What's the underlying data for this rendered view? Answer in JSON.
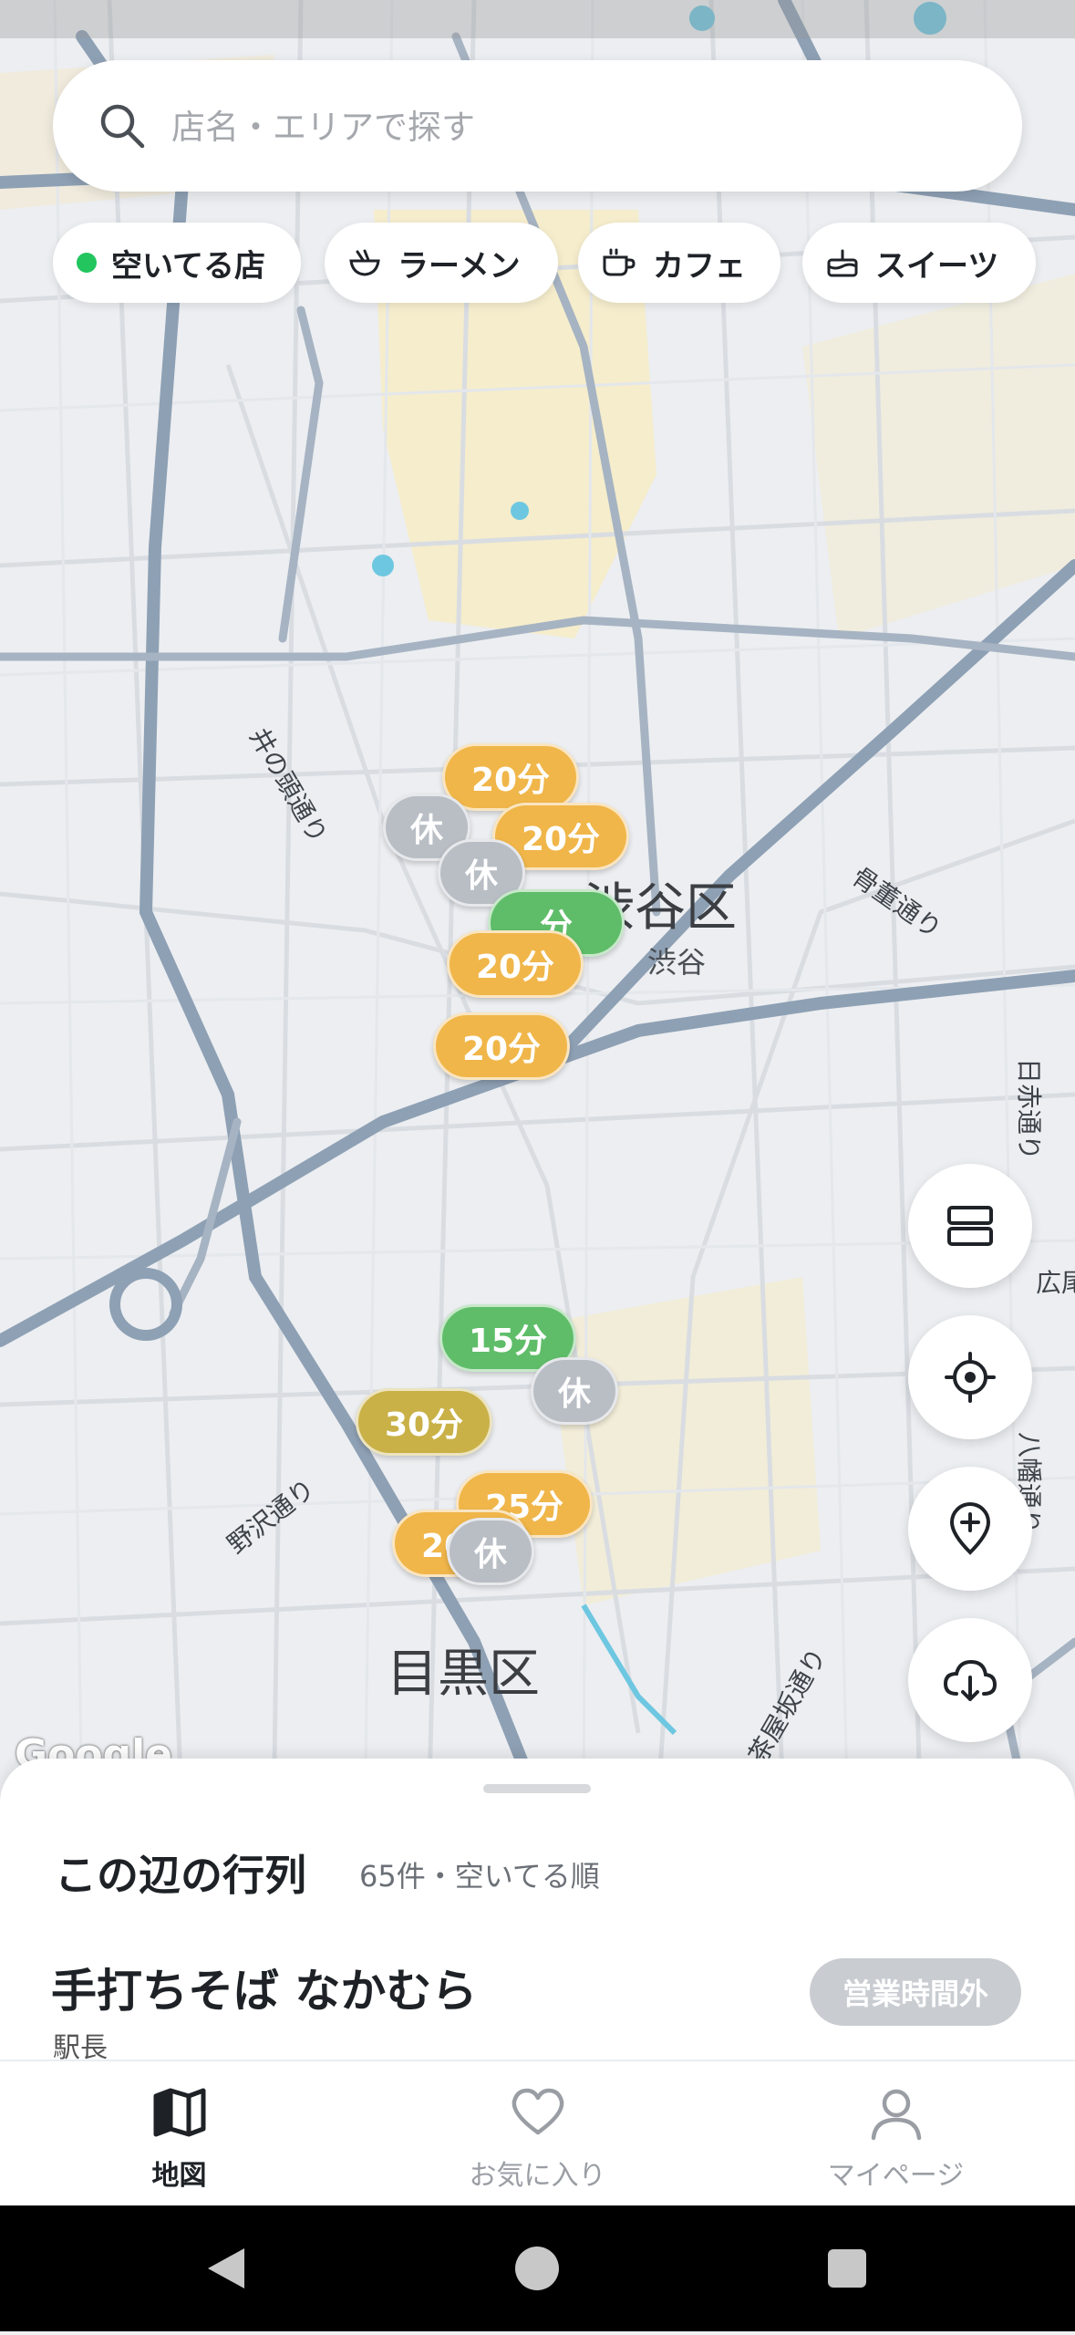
{
  "search": {
    "placeholder": "店名・エリアで探す"
  },
  "filters": [
    {
      "label": "空いてる店",
      "icon": "green-dot-icon"
    },
    {
      "label": "ラーメン",
      "icon": "ramen-bowl-icon"
    },
    {
      "label": "カフェ",
      "icon": "coffee-cup-icon"
    },
    {
      "label": "スイーツ",
      "icon": "cake-icon"
    }
  ],
  "map": {
    "wards": [
      "渋谷区",
      "目黒区"
    ],
    "stations": [
      "渋谷"
    ],
    "roads": [
      "井の頭通り",
      "骨董通り",
      "日赤通り",
      "野沢通り",
      "八幡通り",
      "広尾",
      "茶屋坂通り"
    ],
    "attribution": "Google",
    "colors": {
      "busy": "#f0b64a",
      "vacant": "#5fbd69",
      "closed": "#b9bec5"
    }
  },
  "pins": [
    {
      "label": "20分",
      "status": "orange"
    },
    {
      "label": "休",
      "status": "grey"
    },
    {
      "label": "20分",
      "status": "orange"
    },
    {
      "label": "休",
      "status": "grey"
    },
    {
      "label": "分",
      "status": "green"
    },
    {
      "label": "20分",
      "status": "orange"
    },
    {
      "label": "20分",
      "status": "orange"
    },
    {
      "label": "15分",
      "status": "green"
    },
    {
      "label": "休",
      "status": "grey"
    },
    {
      "label": "30分",
      "status": "olive"
    },
    {
      "label": "25分",
      "status": "orange"
    },
    {
      "label": "20分",
      "status": "orange"
    },
    {
      "label": "休",
      "status": "grey"
    }
  ],
  "fabs": [
    "list-view-icon",
    "my-location-icon",
    "add-pin-icon",
    "download-cloud-icon"
  ],
  "sheet": {
    "title": "この辺の行列",
    "meta": "65件・空いてる順",
    "shop_name": "手打ちそば なかむら",
    "shop_sub": "駅長",
    "badge": "営業時間外"
  },
  "tabs": [
    {
      "label": "地図",
      "icon": "map-icon",
      "active": true
    },
    {
      "label": "お気に入り",
      "icon": "heart-icon",
      "active": false
    },
    {
      "label": "マイページ",
      "icon": "user-icon",
      "active": false
    }
  ]
}
